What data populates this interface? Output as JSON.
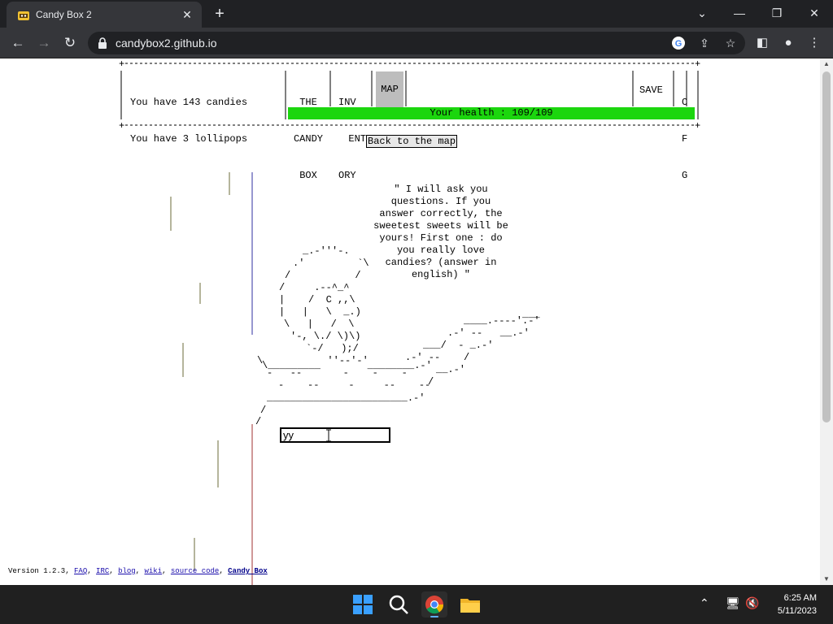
{
  "browser": {
    "tab_title": "Candy Box 2",
    "url": "candybox2.github.io",
    "icons": [
      "candy-favicon",
      "close-icon",
      "plus-icon",
      "minimize-icon",
      "maximize-icon",
      "close-window-icon",
      "back-icon",
      "forward-icon",
      "reload-icon",
      "lock-icon",
      "google-icon",
      "share-icon",
      "star-icon",
      "sidebar-icon",
      "profile-icon",
      "menu-icon"
    ]
  },
  "game": {
    "candies_line": "You have 143 candies",
    "lollipops_line": "You have 3 lollipops",
    "tabs": {
      "candy_box": [
        "THE",
        "CANDY",
        "BOX"
      ],
      "inventory": [
        "INV",
        "ENT",
        "ORY"
      ],
      "map": "MAP"
    },
    "save_label": "SAVE",
    "config_label": [
      "C",
      "F",
      "G"
    ],
    "health": "Your health : 109/109",
    "health_color": "#1bd60e",
    "back_button": "Back to the map",
    "speech": "\"   I will ask you questions. If you answer correctly, the sweetest sweets will be yours! First one : do you really love candies? (answer in english) \"",
    "answer_value": "yy"
  },
  "footer": {
    "version": "Version 1.2.3,",
    "links": [
      "FAQ",
      "IRC",
      "blog",
      "wiki",
      "source code"
    ],
    "candybox": "Candy Box"
  },
  "taskbar": {
    "apps": [
      "windows-start-icon",
      "search-icon",
      "chrome-icon",
      "file-explorer-icon"
    ],
    "time": "6:25 AM",
    "date": "5/11/2023"
  }
}
